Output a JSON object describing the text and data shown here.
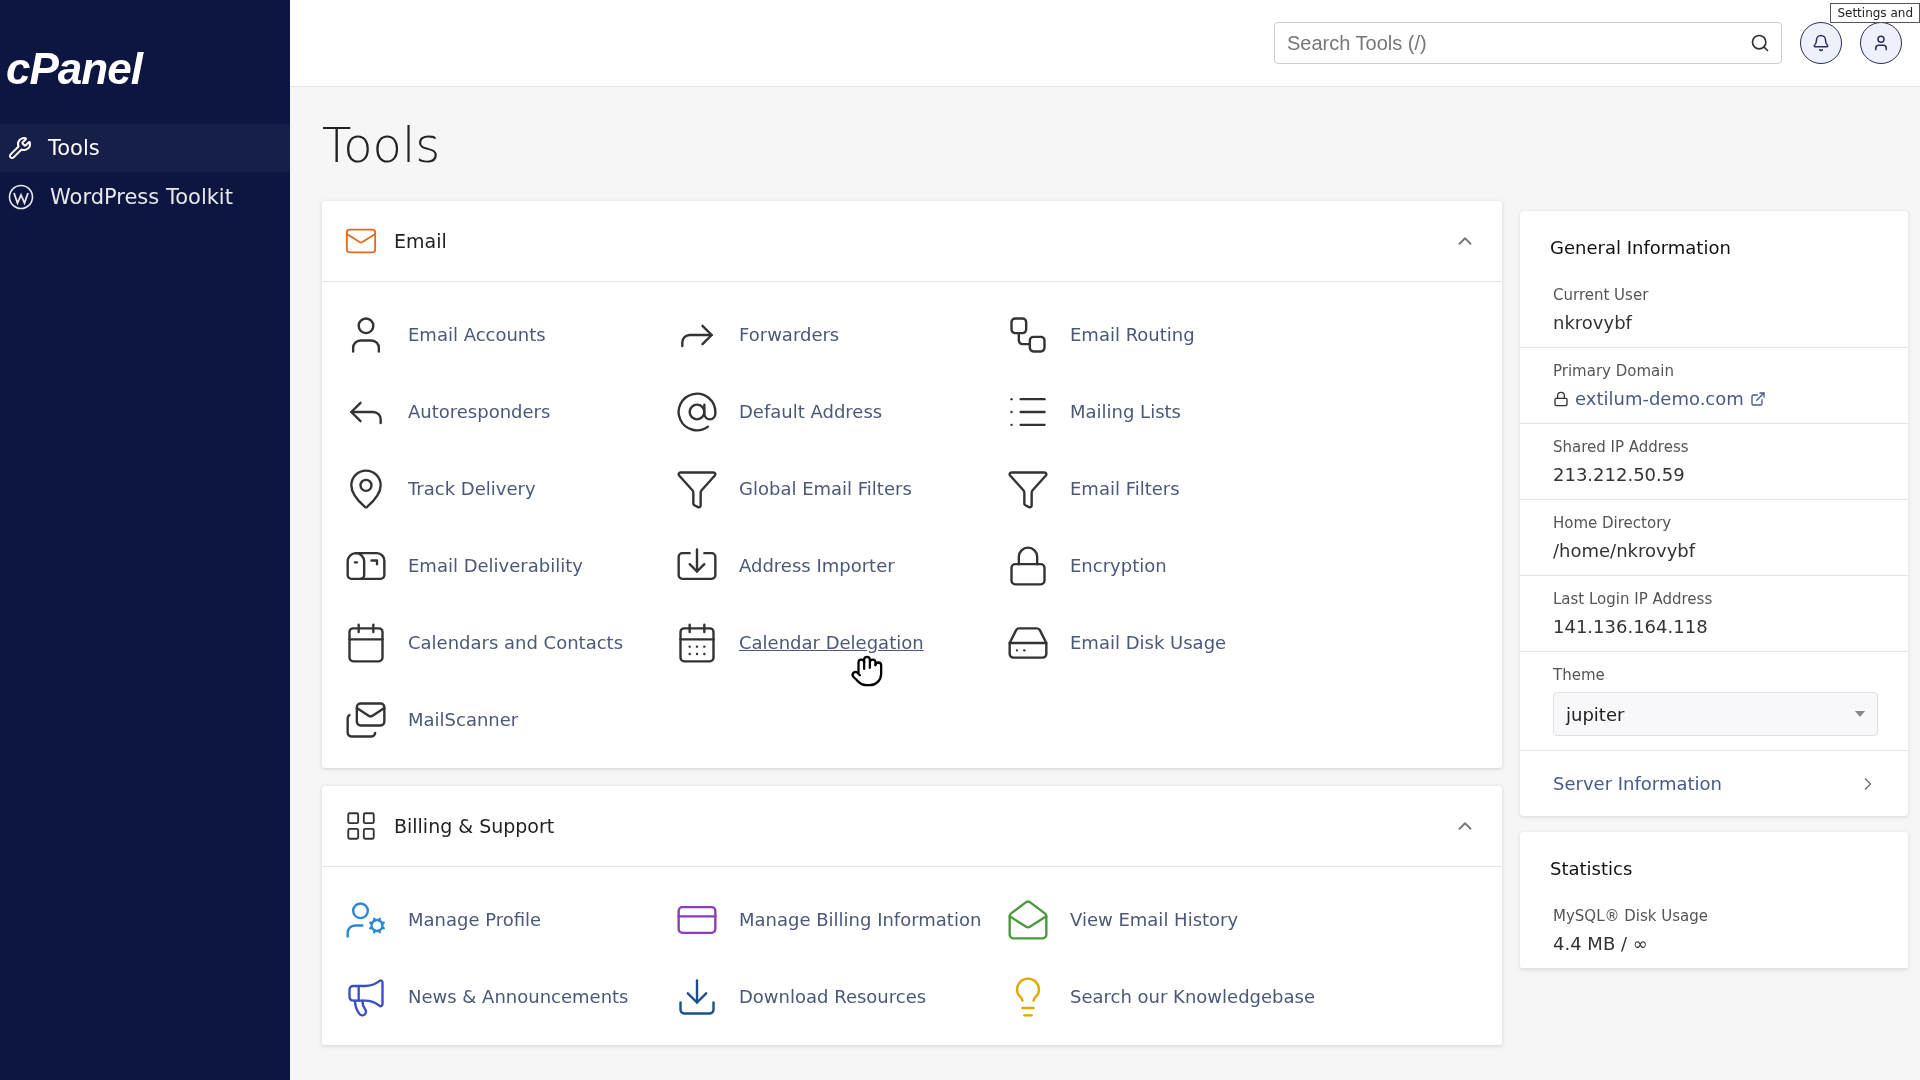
{
  "sidebar": {
    "logo": "cPanel",
    "items": [
      {
        "label": "Tools",
        "selected": true
      },
      {
        "label": "WordPress Toolkit",
        "selected": false
      }
    ]
  },
  "header": {
    "search": {
      "placeholder": "Search Tools (/)"
    },
    "tooltip": "Settings and"
  },
  "page_title": "Tools",
  "sections": [
    {
      "title": "Email",
      "expanded": true,
      "items": [
        {
          "label": "Email Accounts",
          "hovered": false
        },
        {
          "label": "Forwarders",
          "hovered": false
        },
        {
          "label": "Email Routing",
          "hovered": false
        },
        {
          "label": "Autoresponders",
          "hovered": false
        },
        {
          "label": "Default Address",
          "hovered": false
        },
        {
          "label": "Mailing Lists",
          "hovered": false
        },
        {
          "label": "Track Delivery",
          "hovered": false
        },
        {
          "label": "Global Email Filters",
          "hovered": false
        },
        {
          "label": "Email Filters",
          "hovered": false
        },
        {
          "label": "Email Deliverability",
          "hovered": false
        },
        {
          "label": "Address Importer",
          "hovered": false
        },
        {
          "label": "Encryption",
          "hovered": false
        },
        {
          "label": "Calendars and Contacts",
          "hovered": false
        },
        {
          "label": "Calendar Delegation",
          "hovered": true
        },
        {
          "label": "Email Disk Usage",
          "hovered": false
        },
        {
          "label": "MailScanner",
          "hovered": false
        }
      ]
    },
    {
      "title": "Billing & Support",
      "expanded": true,
      "items": [
        {
          "label": "Manage Profile",
          "hovered": false
        },
        {
          "label": "Manage Billing Information",
          "hovered": false
        },
        {
          "label": "View Email History",
          "hovered": false
        },
        {
          "label": "News & Announcements",
          "hovered": false
        },
        {
          "label": "Download Resources",
          "hovered": false
        },
        {
          "label": "Search our Knowledgebase",
          "hovered": false
        }
      ]
    }
  ],
  "general_information": {
    "title": "General Information",
    "fields": [
      {
        "label": "Current User",
        "value": "nkrovybf",
        "kind": "text"
      },
      {
        "label": "Primary Domain",
        "value": "extilum-demo.com",
        "kind": "link"
      },
      {
        "label": "Shared IP Address",
        "value": "213.212.50.59",
        "kind": "text"
      },
      {
        "label": "Home Directory",
        "value": "/home/nkrovybf",
        "kind": "text"
      },
      {
        "label": "Last Login IP Address",
        "value": "141.136.164.118",
        "kind": "text"
      },
      {
        "label": "Theme",
        "value": "jupiter",
        "kind": "select"
      }
    ],
    "server_information": "Server Information"
  },
  "statistics": {
    "title": "Statistics",
    "fields": [
      {
        "label": "MySQL® Disk Usage",
        "value": "4.4 MB / ∞"
      }
    ]
  }
}
